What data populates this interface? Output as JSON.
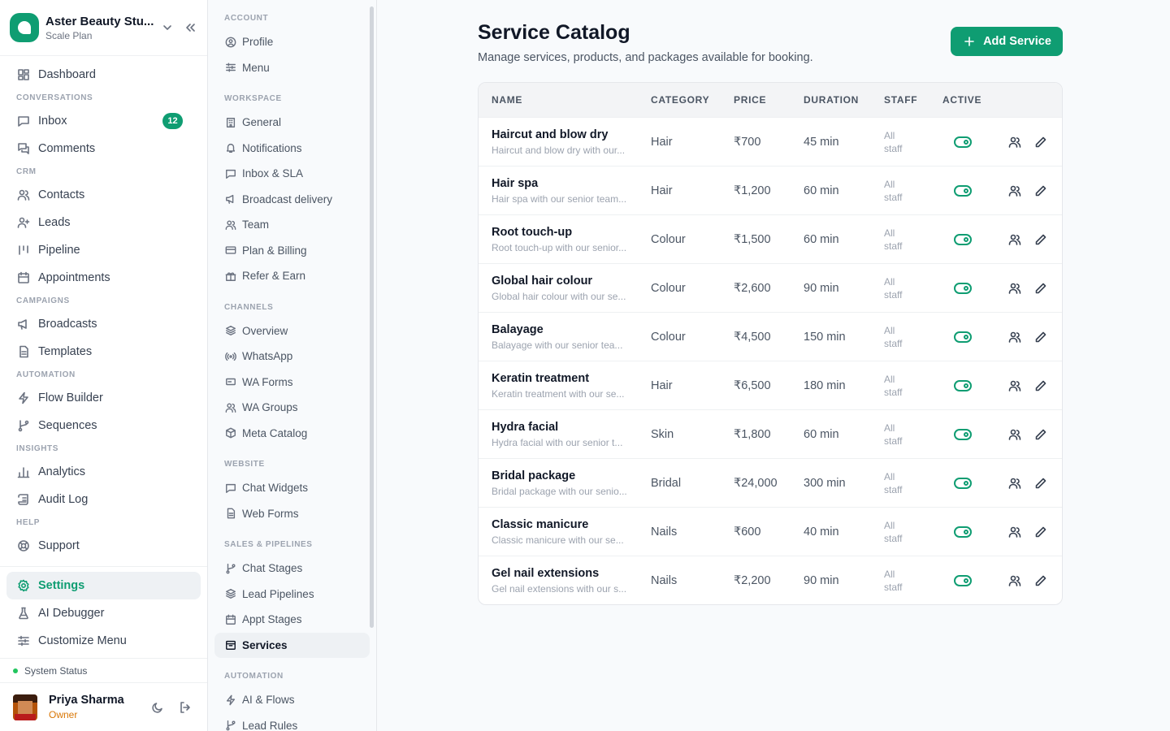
{
  "workspace": {
    "name": "Aster Beauty Stu...",
    "plan": "Scale Plan"
  },
  "nav": {
    "dashboard": "Dashboard",
    "sec_conversations": "CONVERSATIONS",
    "inbox": "Inbox",
    "inbox_count": "12",
    "comments": "Comments",
    "sec_crm": "CRM",
    "contacts": "Contacts",
    "leads": "Leads",
    "pipeline": "Pipeline",
    "appointments": "Appointments",
    "sec_campaigns": "CAMPAIGNS",
    "broadcasts": "Broadcasts",
    "templates": "Templates",
    "sec_automation": "AUTOMATION",
    "flow_builder": "Flow Builder",
    "sequences": "Sequences",
    "sec_insights": "INSIGHTS",
    "analytics": "Analytics",
    "audit_log": "Audit Log",
    "sec_help": "HELP",
    "support": "Support"
  },
  "footer": {
    "settings": "Settings",
    "ai_debugger": "AI Debugger",
    "customize_menu": "Customize Menu",
    "system_status": "System Status"
  },
  "user": {
    "name": "Priya Sharma",
    "role": "Owner"
  },
  "settings_nav": {
    "sec_account": "ACCOUNT",
    "profile": "Profile",
    "menu": "Menu",
    "sec_workspace": "WORKSPACE",
    "general": "General",
    "notifications": "Notifications",
    "inbox_sla": "Inbox & SLA",
    "broadcast_delivery": "Broadcast delivery",
    "team": "Team",
    "plan_billing": "Plan & Billing",
    "refer_earn": "Refer & Earn",
    "sec_channels": "CHANNELS",
    "overview": "Overview",
    "whatsapp": "WhatsApp",
    "wa_forms": "WA Forms",
    "wa_groups": "WA Groups",
    "meta_catalog": "Meta Catalog",
    "sec_website": "WEBSITE",
    "chat_widgets": "Chat Widgets",
    "web_forms": "Web Forms",
    "sec_sales": "SALES & PIPELINES",
    "chat_stages": "Chat Stages",
    "lead_pipelines": "Lead Pipelines",
    "appt_stages": "Appt Stages",
    "services": "Services",
    "sec_automation": "AUTOMATION",
    "ai_flows": "AI & Flows",
    "lead_rules": "Lead Rules"
  },
  "page": {
    "title": "Service Catalog",
    "subtitle": "Manage services, products, and packages available for booking.",
    "add_button": "Add Service"
  },
  "table": {
    "headers": {
      "name": "NAME",
      "category": "CATEGORY",
      "price": "PRICE",
      "duration": "DURATION",
      "staff": "STAFF",
      "active": "ACTIVE"
    },
    "rows": [
      {
        "name": "Haircut and blow dry",
        "desc": "Haircut and blow dry with our...",
        "category": "Hair",
        "price": "₹700",
        "duration": "45 min",
        "staff": "All staff"
      },
      {
        "name": "Hair spa",
        "desc": "Hair spa with our senior team...",
        "category": "Hair",
        "price": "₹1,200",
        "duration": "60 min",
        "staff": "All staff"
      },
      {
        "name": "Root touch-up",
        "desc": "Root touch-up with our senior...",
        "category": "Colour",
        "price": "₹1,500",
        "duration": "60 min",
        "staff": "All staff"
      },
      {
        "name": "Global hair colour",
        "desc": "Global hair colour with our se...",
        "category": "Colour",
        "price": "₹2,600",
        "duration": "90 min",
        "staff": "All staff"
      },
      {
        "name": "Balayage",
        "desc": "Balayage with our senior tea...",
        "category": "Colour",
        "price": "₹4,500",
        "duration": "150 min",
        "staff": "All staff"
      },
      {
        "name": "Keratin treatment",
        "desc": "Keratin treatment with our se...",
        "category": "Hair",
        "price": "₹6,500",
        "duration": "180 min",
        "staff": "All staff"
      },
      {
        "name": "Hydra facial",
        "desc": "Hydra facial with our senior t...",
        "category": "Skin",
        "price": "₹1,800",
        "duration": "60 min",
        "staff": "All staff"
      },
      {
        "name": "Bridal package",
        "desc": "Bridal package with our senio...",
        "category": "Bridal",
        "price": "₹24,000",
        "duration": "300 min",
        "staff": "All staff"
      },
      {
        "name": "Classic manicure",
        "desc": "Classic manicure with our se...",
        "category": "Nails",
        "price": "₹600",
        "duration": "40 min",
        "staff": "All staff"
      },
      {
        "name": "Gel nail extensions",
        "desc": "Gel nail extensions with our s...",
        "category": "Nails",
        "price": "₹2,200",
        "duration": "90 min",
        "staff": "All staff"
      }
    ]
  },
  "colors": {
    "accent": "#0f9d72",
    "status_ok": "#22c55e",
    "owner_role": "#d97706"
  }
}
